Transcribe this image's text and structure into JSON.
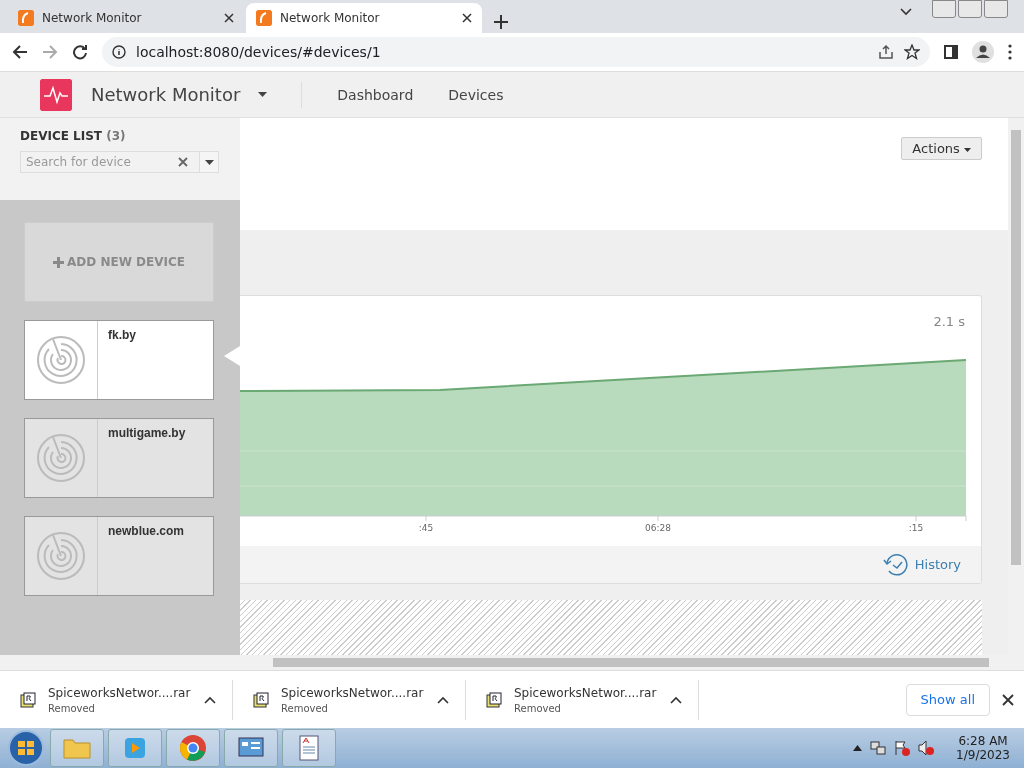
{
  "browser": {
    "tabs": [
      {
        "title": "Network Monitor",
        "selected": false
      },
      {
        "title": "Network Monitor",
        "selected": true
      }
    ],
    "url": "localhost:8080/devices/#devices/1"
  },
  "app": {
    "title": "Network Monitor",
    "nav": [
      "Dashboard",
      "Devices"
    ]
  },
  "sidebar": {
    "title": "DEVICE LIST",
    "count": "(3)",
    "search": {
      "placeholder": "Search for device"
    },
    "add_button": "ADD NEW DEVICE",
    "devices": [
      {
        "name": "fk.by",
        "selected": true
      },
      {
        "name": "multigame.by",
        "selected": false
      },
      {
        "name": "newblue.com",
        "selected": false
      }
    ]
  },
  "main": {
    "actions_button": "Actions",
    "chart": {
      "value_label": "2.1 s",
      "x_labels": [
        ":45",
        "06:28",
        ":15"
      ]
    },
    "history_link": "History"
  },
  "downloads": {
    "items": [
      {
        "name": "SpiceworksNetwor....rar",
        "status": "Removed"
      },
      {
        "name": "SpiceworksNetwor....rar",
        "status": "Removed"
      },
      {
        "name": "SpiceworksNetwor....rar",
        "status": "Removed"
      }
    ],
    "show_all": "Show all"
  },
  "taskbar": {
    "time": "6:28 AM",
    "date": "1/9/2023"
  }
}
